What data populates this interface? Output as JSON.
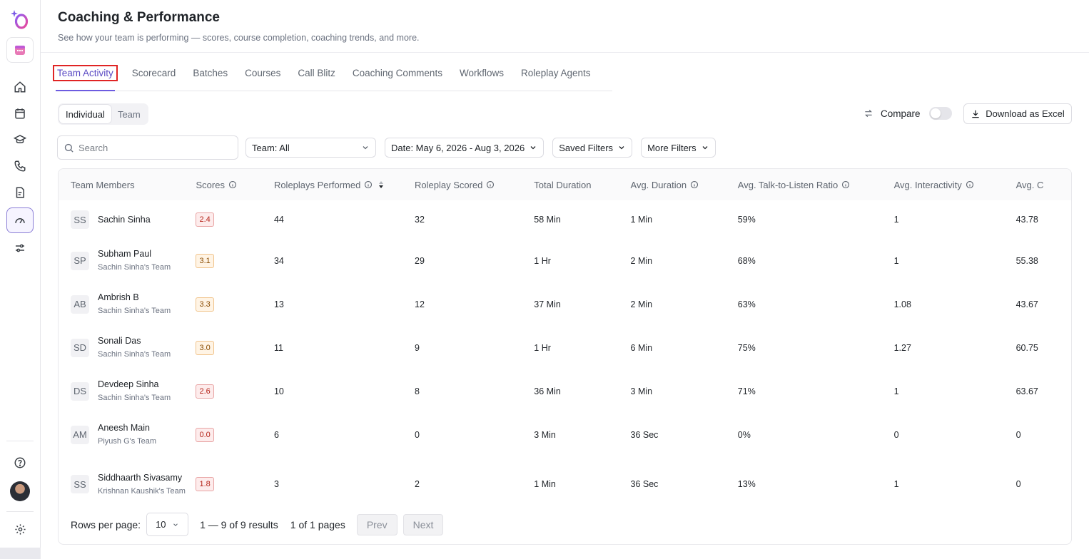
{
  "header": {
    "title": "Coaching & Performance",
    "subtitle": "See how your team is performing — scores, course completion, coaching trends, and more."
  },
  "tabs": [
    {
      "label": "Team Activity",
      "active": true
    },
    {
      "label": "Scorecard"
    },
    {
      "label": "Batches"
    },
    {
      "label": "Courses"
    },
    {
      "label": "Call Blitz"
    },
    {
      "label": "Coaching Comments"
    },
    {
      "label": "Workflows"
    },
    {
      "label": "Roleplay Agents"
    }
  ],
  "view_toggle": {
    "individual": "Individual",
    "team": "Team",
    "selected": "Individual"
  },
  "compare": {
    "label": "Compare",
    "enabled": false
  },
  "download_label": "Download as Excel",
  "filters": {
    "search_placeholder": "Search",
    "team": "Team: All",
    "date": "Date: May 6, 2026 - Aug 3, 2026",
    "saved": "Saved Filters",
    "more": "More Filters"
  },
  "table": {
    "columns": [
      "Team Members",
      "Scores",
      "Roleplays Performed",
      "Roleplay Scored",
      "Total Duration",
      "Avg. Duration",
      "Avg. Talk-to-Listen Ratio",
      "Avg. Interactivity",
      "Avg. C"
    ],
    "rows": [
      {
        "initials": "SS",
        "name": "Sachin Sinha",
        "team": "",
        "score": "2.4",
        "score_color": "red",
        "performed": "44",
        "scored": "32",
        "total_duration": "58 Min",
        "avg_duration": "1 Min",
        "talk_listen": "59%",
        "interactivity": "1",
        "last": "43.78"
      },
      {
        "initials": "SP",
        "name": "Subham Paul",
        "team": "Sachin Sinha's Team",
        "score": "3.1",
        "score_color": "orange",
        "performed": "34",
        "scored": "29",
        "total_duration": "1 Hr",
        "avg_duration": "2 Min",
        "talk_listen": "68%",
        "interactivity": "1",
        "last": "55.38"
      },
      {
        "initials": "AB",
        "name": "Ambrish B",
        "team": "Sachin Sinha's Team",
        "score": "3.3",
        "score_color": "orange",
        "performed": "13",
        "scored": "12",
        "total_duration": "37 Min",
        "avg_duration": "2 Min",
        "talk_listen": "63%",
        "interactivity": "1.08",
        "last": "43.67"
      },
      {
        "initials": "SD",
        "name": "Sonali Das",
        "team": "Sachin Sinha's Team",
        "score": "3.0",
        "score_color": "orange",
        "performed": "11",
        "scored": "9",
        "total_duration": "1 Hr",
        "avg_duration": "6 Min",
        "talk_listen": "75%",
        "interactivity": "1.27",
        "last": "60.75"
      },
      {
        "initials": "DS",
        "name": "Devdeep Sinha",
        "team": "Sachin Sinha's Team",
        "score": "2.6",
        "score_color": "red",
        "performed": "10",
        "scored": "8",
        "total_duration": "36 Min",
        "avg_duration": "3 Min",
        "talk_listen": "71%",
        "interactivity": "1",
        "last": "63.67"
      },
      {
        "initials": "AM",
        "name": "Aneesh Main",
        "team": "Piyush G's Team",
        "score": "0.0",
        "score_color": "red",
        "performed": "6",
        "scored": "0",
        "total_duration": "3 Min",
        "avg_duration": "36 Sec",
        "talk_listen": "0%",
        "interactivity": "0",
        "last": "0"
      },
      {
        "initials": "SS",
        "name": "Siddhaarth Sivasamy",
        "team": "Krishnan Kaushik's Team",
        "score": "1.8",
        "score_color": "red",
        "performed": "3",
        "scored": "2",
        "total_duration": "1 Min",
        "avg_duration": "36 Sec",
        "talk_listen": "13%",
        "interactivity": "1",
        "last": "0"
      }
    ]
  },
  "pagination": {
    "rows_label": "Rows per page:",
    "rows_value": "10",
    "results": "1 — 9 of 9 results",
    "pages": "1 of 1 pages",
    "prev": "Prev",
    "next": "Next"
  },
  "colors": {
    "accent": "#6d5ce0",
    "highlight": "#e02424"
  }
}
